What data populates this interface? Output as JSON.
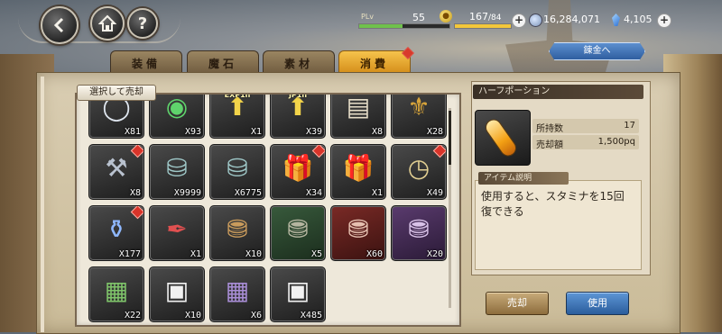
{
  "header": {
    "plv_label": "PLv",
    "plv_value": "55",
    "plv_progress": 0.48,
    "stamina_current": "167",
    "stamina_max": "/84",
    "stamina_progress": 1.0,
    "money": "16,284,071",
    "gems": "4,105",
    "exchange_label": "錬金へ",
    "nav_icons": [
      "back-arrow-icon",
      "home-icon",
      "help-icon"
    ]
  },
  "tabs": [
    {
      "label": "装備",
      "active": false,
      "badge": false
    },
    {
      "label": "魔石",
      "active": false,
      "badge": false
    },
    {
      "label": "素材",
      "active": false,
      "badge": false
    },
    {
      "label": "消費",
      "active": true,
      "badge": true
    }
  ],
  "grid": {
    "select_sell_label": "選択して売却",
    "items": [
      {
        "icon": "silver-orb-icon",
        "qty": "X81",
        "badge": false,
        "tint": "normal"
      },
      {
        "icon": "green-orb-icon",
        "qty": "X93",
        "badge": false,
        "tint": "normal"
      },
      {
        "icon": "exp-boost-icon",
        "label": "EXP1h",
        "qty": "X1",
        "badge": false,
        "tint": "normal"
      },
      {
        "icon": "jp-boost-icon",
        "label": "JP1h",
        "qty": "X39",
        "badge": false,
        "tint": "normal"
      },
      {
        "icon": "book-icon",
        "qty": "X8",
        "badge": false,
        "tint": "normal"
      },
      {
        "icon": "tassel-icon",
        "qty": "X28",
        "badge": false,
        "tint": "normal"
      },
      {
        "icon": "hammer-icon",
        "qty": "X8",
        "badge": true,
        "tint": "normal"
      },
      {
        "icon": "canister-icon",
        "qty": "X9999",
        "badge": false,
        "tint": "normal"
      },
      {
        "icon": "canister-icon",
        "qty": "X6775",
        "badge": false,
        "tint": "normal"
      },
      {
        "icon": "blue-gift-icon",
        "qty": "X34",
        "badge": true,
        "tint": "normal"
      },
      {
        "icon": "red-gift-icon",
        "qty": "X1",
        "badge": false,
        "tint": "normal"
      },
      {
        "icon": "pocket-watch-icon",
        "qty": "X49",
        "badge": true,
        "tint": "normal"
      },
      {
        "icon": "potion-flask-icon",
        "qty": "X177",
        "badge": true,
        "tint": "normal"
      },
      {
        "icon": "quill-ink-icon",
        "qty": "X1",
        "badge": false,
        "tint": "normal"
      },
      {
        "icon": "bronze-chest-icon",
        "qty": "X10",
        "badge": false,
        "tint": "normal"
      },
      {
        "icon": "green-chest-icon",
        "qty": "X5",
        "badge": false,
        "tint": "green"
      },
      {
        "icon": "red-chest-icon",
        "qty": "X60",
        "badge": false,
        "tint": "red"
      },
      {
        "icon": "purple-chest-icon",
        "qty": "X20",
        "badge": false,
        "tint": "purple"
      },
      {
        "icon": "green-scroll-icon",
        "qty": "X22",
        "badge": false,
        "tint": "normal"
      },
      {
        "icon": "white-pedestal-icon",
        "qty": "X10",
        "badge": false,
        "tint": "normal"
      },
      {
        "icon": "purple-scroll-icon",
        "qty": "X6",
        "badge": false,
        "tint": "normal"
      },
      {
        "icon": "white-pedestal-icon",
        "qty": "X485",
        "badge": false,
        "tint": "normal"
      }
    ]
  },
  "detail": {
    "name": "ハーフポーション",
    "owned_label": "所持数",
    "owned_value": "17",
    "price_label": "売却額",
    "price_value": "1,500pq",
    "desc_header": "アイテム説明",
    "description": "使用すると、スタミナを15回復できる",
    "sell_button": "売却",
    "use_button": "使用"
  }
}
